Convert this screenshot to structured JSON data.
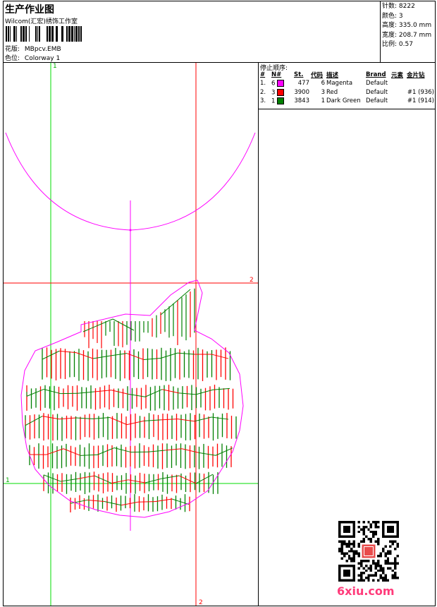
{
  "header": {
    "title": "生产作业图",
    "company": "Wilcom(汇宏)绣饰工作室",
    "design_label": "花版:",
    "design_value": "MBpcv.EMB",
    "colorway_label": "色位:",
    "colorway_value": "Colorway 1"
  },
  "info": [
    {
      "label": "针数:",
      "value": "8222"
    },
    {
      "label": "颜色:",
      "value": "3"
    },
    {
      "label": "高度:",
      "value": "335.0 mm"
    },
    {
      "label": "宽度:",
      "value": "208.7 mm"
    },
    {
      "label": "比例:",
      "value": "0.57"
    }
  ],
  "stop_sequence": {
    "title": "停止顺序:",
    "columns": [
      "#",
      "N#",
      "St.",
      "代码",
      "描述",
      "Brand",
      "元素",
      "金片钻"
    ],
    "rows": [
      {
        "idx": "1.",
        "n": "6",
        "color": "#ff00ff",
        "st": "477",
        "code": "6",
        "desc": "Magenta",
        "brand": "Default",
        "element": "",
        "sequin": ""
      },
      {
        "idx": "2.",
        "n": "3",
        "color": "#ff0000",
        "st": "3900",
        "code": "3",
        "desc": "Red",
        "brand": "Default",
        "element": "",
        "sequin": "#1 (936)"
      },
      {
        "idx": "3.",
        "n": "1",
        "color": "#008000",
        "st": "3843",
        "code": "1",
        "desc": "Dark Green",
        "brand": "Default",
        "element": "",
        "sequin": "#1 (914)"
      }
    ]
  },
  "axis_labels": {
    "green_top": "1",
    "green_left": "1",
    "red_right": "2",
    "red_bottom": "2"
  },
  "watermark": "6xiu.com",
  "colors": {
    "magenta": "#ff00ff",
    "red": "#ff0000",
    "green": "#008000",
    "guide_green": "#00cc00"
  }
}
